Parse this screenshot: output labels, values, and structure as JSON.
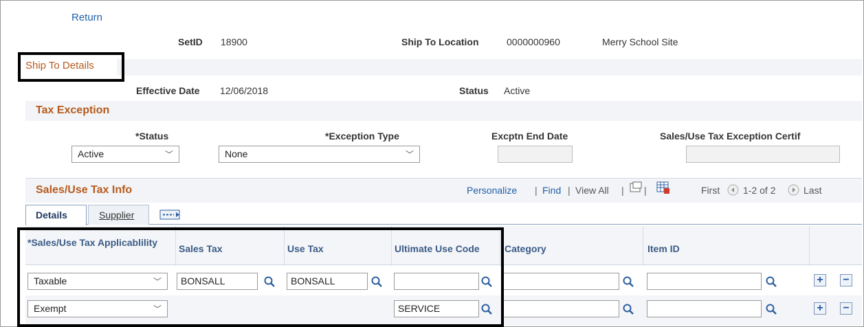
{
  "nav": {
    "return_link": "Return"
  },
  "header": {
    "setid_label": "SetID",
    "setid_value": "18900",
    "ship_to_label": "Ship To Location",
    "ship_to_value": "0000000960",
    "ship_to_desc": "Merry School Site"
  },
  "ship_to_details": {
    "title": "Ship To Details",
    "eff_date_label": "Effective Date",
    "eff_date_value": "12/06/2018",
    "status_label": "Status",
    "status_value": "Active"
  },
  "tax_exception": {
    "title": "Tax Exception",
    "status_label": "*Status",
    "status_value": "Active",
    "exception_type_label": "*Exception Type",
    "exception_type_value": "None",
    "end_date_label": "Excptn End Date",
    "end_date_value": "",
    "cert_label": "Sales/Use Tax Exception Certif",
    "cert_value": ""
  },
  "sales_use": {
    "title": "Sales/Use Tax Info",
    "personalize": "Personalize",
    "find": "Find",
    "view_all": "View All",
    "first": "First",
    "range": "1-2 of 2",
    "last": "Last",
    "tabs": [
      {
        "label": "Details"
      },
      {
        "label": "Supplier"
      }
    ],
    "columns": [
      "*Sales/Use Tax Applicablility",
      "Sales Tax",
      "Use Tax",
      "Ultimate Use Code",
      "Category",
      "Item ID"
    ],
    "rows": [
      {
        "applicability": "Taxable",
        "sales_tax": "BONSALL",
        "use_tax": "BONSALL",
        "ultimate_use": "",
        "category": "",
        "item_id": ""
      },
      {
        "applicability": "Exempt",
        "ultimate_use": "SERVICE",
        "category": "",
        "item_id": ""
      }
    ]
  },
  "colors": {
    "link": "#1f5fa8",
    "section_title": "#b75a1c",
    "header_text": "#3b5b86",
    "band": "#f2f4f7"
  },
  "icons": [
    "magnifier-icon",
    "zoom-grid-icon",
    "download-icon",
    "arrow-left-icon",
    "arrow-right-icon",
    "show-all-columns-icon",
    "plus-icon",
    "minus-icon"
  ]
}
